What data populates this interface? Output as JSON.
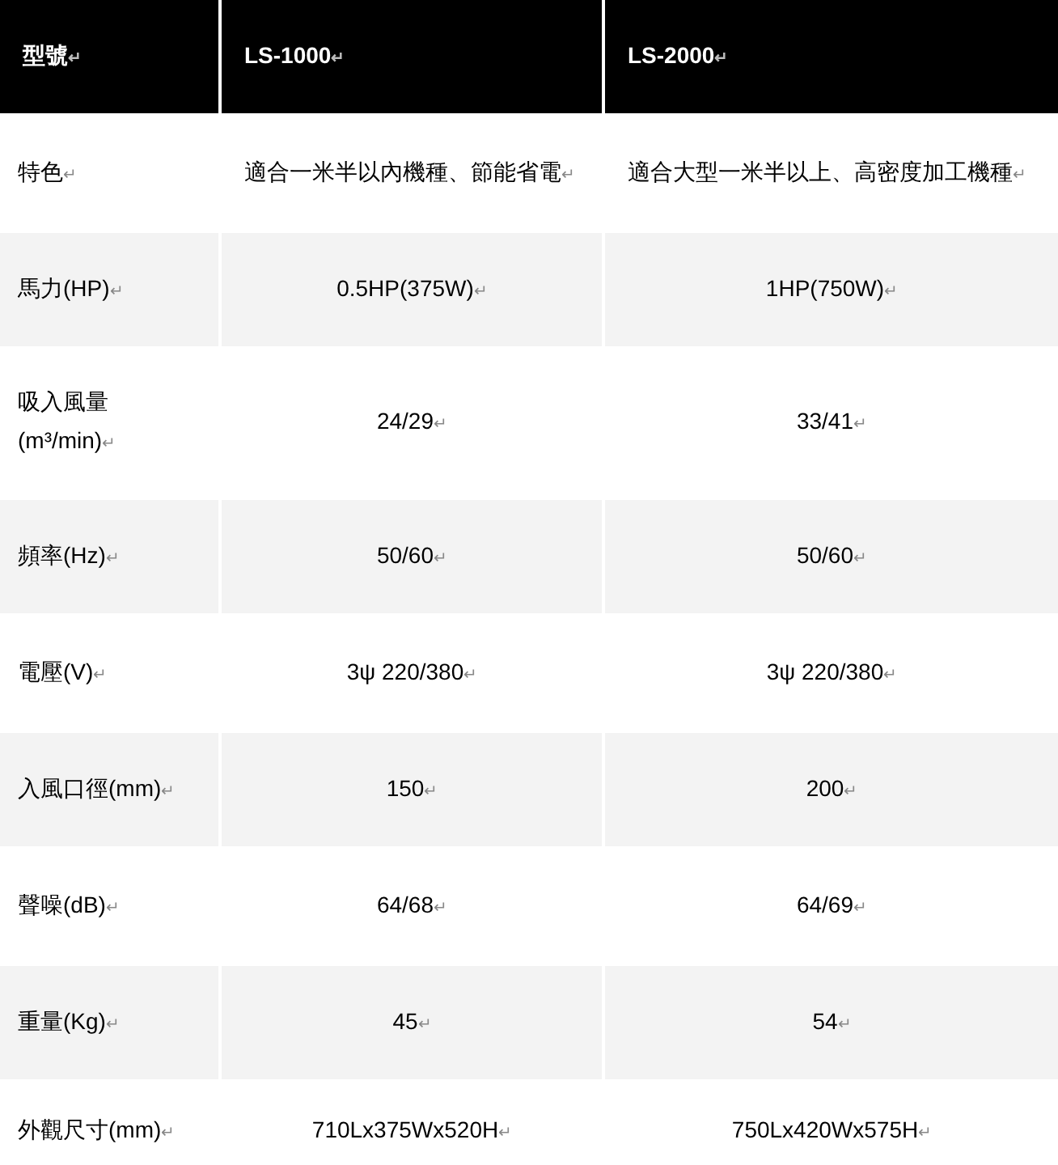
{
  "table": {
    "columns": [
      "型號↵",
      "LS-1000↵",
      "LS-2000↵"
    ],
    "rows": [
      {
        "cells": [
          "特色↵",
          "適合一米半以內機種、節能省電↵",
          "適合大型一米半以上、高密度加工機種↵"
        ]
      },
      {
        "cells": [
          "馬力(HP)↵",
          "0.5HP(375W)↵",
          "1HP(750W)↵"
        ]
      },
      {
        "cells": [
          "吸入風量\n(m³/min)↵",
          "24/29↵",
          "33/41↵"
        ]
      },
      {
        "cells": [
          "頻率(Hz)↵",
          "50/60↵",
          "50/60↵"
        ]
      },
      {
        "cells": [
          "電壓(V)↵",
          "3ψ 220/380↵",
          "3ψ 220/380↵"
        ]
      },
      {
        "cells": [
          "入風口徑(mm)↵",
          "150↵",
          "200↵"
        ]
      },
      {
        "cells": [
          "聲噪(dB)↵",
          "64/68↵",
          "64/69↵"
        ]
      },
      {
        "cells": [
          "重量(Kg)↵",
          "45↵",
          "54↵"
        ]
      },
      {
        "cells": [
          "外觀尺寸(mm)↵",
          "710Lx375Wx520H↵",
          "750Lx420Wx575H↵"
        ]
      }
    ]
  }
}
